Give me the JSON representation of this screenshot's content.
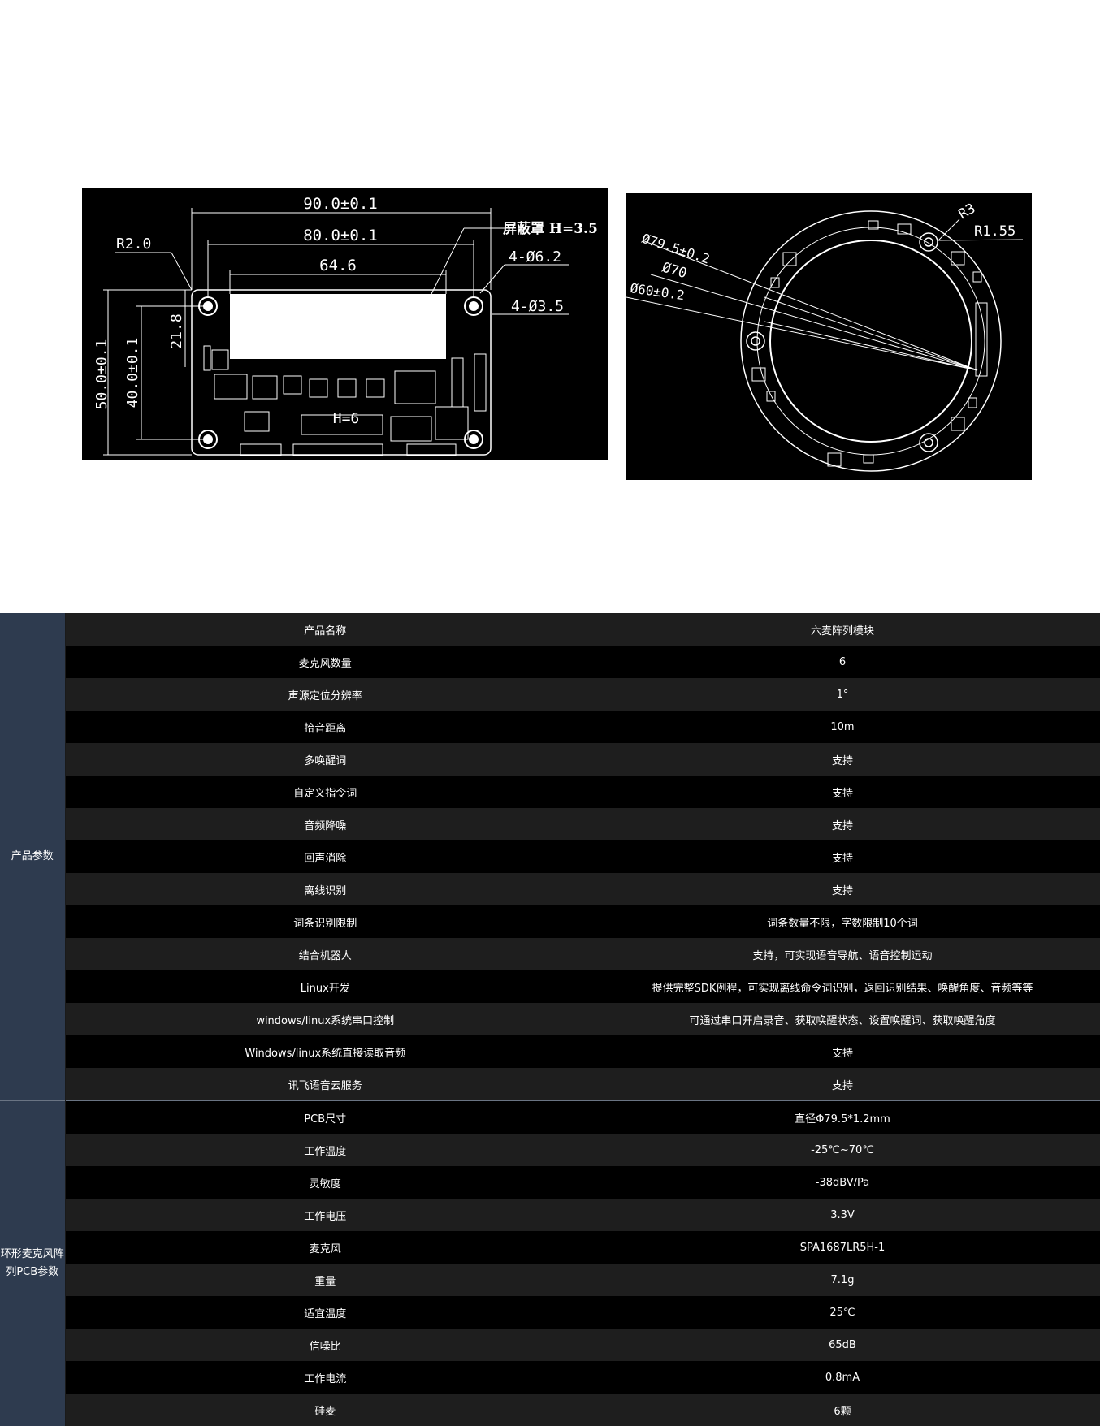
{
  "drawing_left": {
    "dims": {
      "w_outer": "90.0±0.1",
      "w_mid": "80.0±0.1",
      "w_inner": "64.6",
      "radius": "R2.0",
      "h_outer": "50.0±0.1",
      "h_mid": "40.0±0.1",
      "h_small": "21.8",
      "shield": "屏蔽罩 H=3.5",
      "hole_large": "4-Ø6.2",
      "hole_small": "4-Ø3.5",
      "connector_h": "H=6"
    }
  },
  "drawing_right": {
    "dims": {
      "d_outer": "Ø79.5±0.2",
      "d_mid": "Ø70",
      "d_inner": "Ø60±0.2",
      "r3": "R3",
      "r155": "R1.55"
    }
  },
  "table": {
    "groups": [
      {
        "name": "产品参数",
        "rows": [
          {
            "label": "产品名称",
            "value": "六麦阵列模块"
          },
          {
            "label": "麦克风数量",
            "value": "6"
          },
          {
            "label": "声源定位分辨率",
            "value": "1°"
          },
          {
            "label": "拾音距离",
            "value": "10m"
          },
          {
            "label": "多唤醒词",
            "value": "支持"
          },
          {
            "label": "自定义指令词",
            "value": "支持"
          },
          {
            "label": "音频降噪",
            "value": "支持"
          },
          {
            "label": "回声消除",
            "value": "支持"
          },
          {
            "label": "离线识别",
            "value": "支持"
          },
          {
            "label": "词条识别限制",
            "value": "词条数量不限，字数限制10个词"
          },
          {
            "label": "结合机器人",
            "value": "支持，可实现语音导航、语音控制运动"
          },
          {
            "label": "Linux开发",
            "value": "提供完整SDK例程，可实现离线命令词识别，返回识别结果、唤醒角度、音频等等"
          },
          {
            "label": "windows/linux系统串口控制",
            "value": "可通过串口开启录音、获取唤醒状态、设置唤醒词、获取唤醒角度"
          },
          {
            "label": "Windows/linux系统直接读取音频",
            "value": "支持"
          },
          {
            "label": "讯飞语音云服务",
            "value": "支持"
          }
        ]
      },
      {
        "name": "环形麦克风阵列PCB参数",
        "rows": [
          {
            "label": "PCB尺寸",
            "value": "直径Φ79.5*1.2mm"
          },
          {
            "label": "工作温度",
            "value": "-25℃~70℃"
          },
          {
            "label": "灵敏度",
            "value": "-38dBV/Pa"
          },
          {
            "label": "工作电压",
            "value": "3.3V"
          },
          {
            "label": "麦克风",
            "value": "SPA1687LR5H-1"
          },
          {
            "label": "重量",
            "value": "7.1g"
          },
          {
            "label": "适宜温度",
            "value": "25℃"
          },
          {
            "label": "信噪比",
            "value": "65dB"
          },
          {
            "label": "工作电流",
            "value": "0.8mA"
          },
          {
            "label": "硅麦",
            "value": "6颗"
          }
        ]
      }
    ]
  }
}
